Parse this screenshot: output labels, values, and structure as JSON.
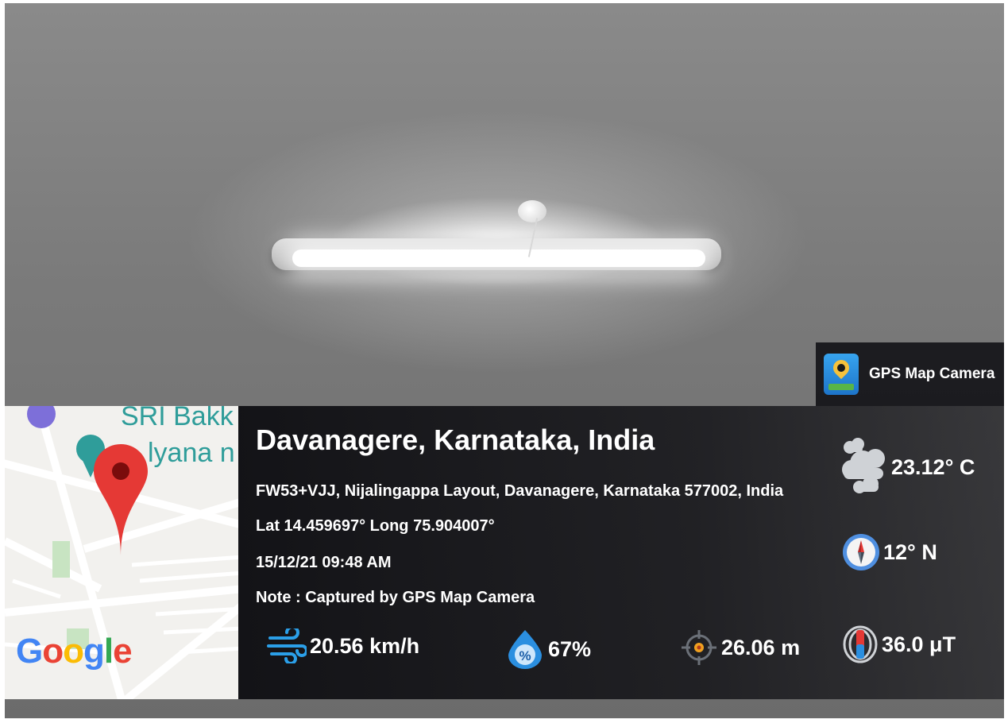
{
  "app": {
    "name": "GPS Map Camera"
  },
  "map": {
    "labels": [
      "SRI Bakk",
      "lyana n"
    ],
    "google": [
      "G",
      "o",
      "o",
      "g",
      "l",
      "e"
    ],
    "google_colors": [
      "#4285F4",
      "#EA4335",
      "#FBBC05",
      "#4285F4",
      "#34A853",
      "#EA4335"
    ]
  },
  "location": {
    "title": "Davanagere, Karnataka, India",
    "address": "FW53+VJJ, Nijalingappa Layout, Davanagere, Karnataka 577002, India",
    "latlong": "Lat 14.459697° Long 75.904007°",
    "datetime": "15/12/21 09:48 AM",
    "note": "Note : Captured by GPS Map Camera"
  },
  "metrics": {
    "wind": "20.56 km/h",
    "humidity": "67%",
    "altitude": "26.06 m",
    "temperature": "23.12° C",
    "compass": "12° N",
    "magnetic": "36.0 μT"
  },
  "colors": {
    "accent": "#2b8fe0",
    "marker": "#e53935"
  }
}
